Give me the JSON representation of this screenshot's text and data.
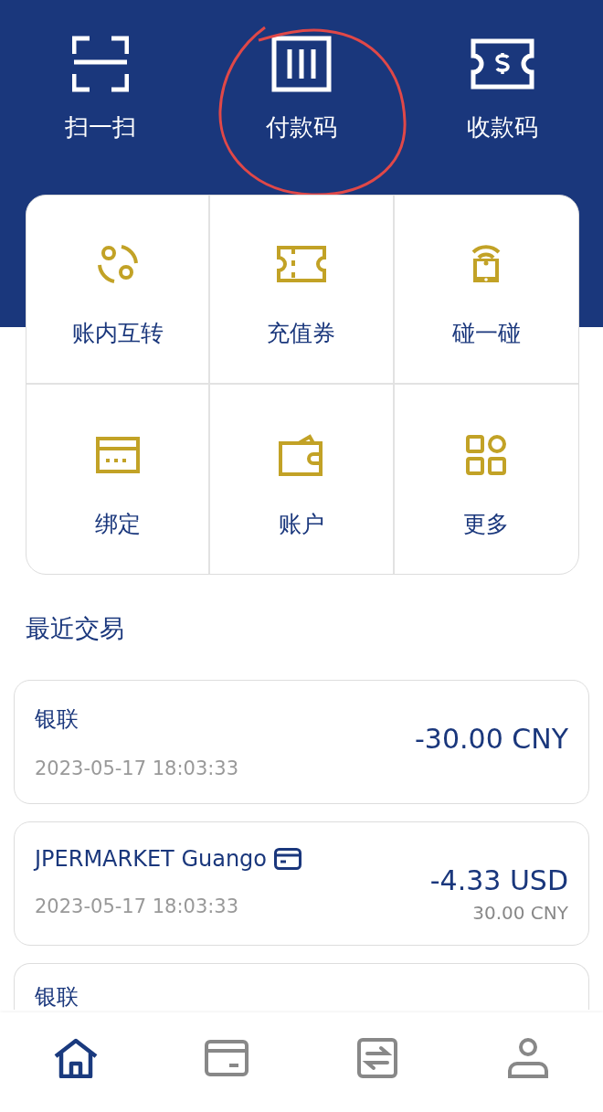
{
  "top_actions": [
    {
      "kind": "scan",
      "label": "扫一扫"
    },
    {
      "kind": "paycode",
      "label": "付款码"
    },
    {
      "kind": "receive",
      "label": "收款码"
    }
  ],
  "services": [
    {
      "kind": "transfer",
      "label": "账内互转"
    },
    {
      "kind": "voucher",
      "label": "充值券"
    },
    {
      "kind": "tap",
      "label": "碰一碰"
    },
    {
      "kind": "bind",
      "label": "绑定"
    },
    {
      "kind": "account",
      "label": "账户"
    },
    {
      "kind": "more",
      "label": "更多"
    }
  ],
  "recent": {
    "title": "最近交易",
    "transactions": [
      {
        "merchant": "银联",
        "card_icon": false,
        "time": "2023-05-17 18:03:33",
        "amount": "-30.00 CNY"
      },
      {
        "merchant": "JPERMARKET Guango",
        "card_icon": true,
        "time": "2023-05-17 18:03:33",
        "amount": "-4.33 USD",
        "converted": "30.00 CNY"
      },
      {
        "merchant": "银联",
        "card_icon": false
      }
    ]
  },
  "bottom_nav": [
    {
      "kind": "home",
      "selected": true
    },
    {
      "kind": "card",
      "selected": false
    },
    {
      "kind": "transfer",
      "selected": false
    },
    {
      "kind": "profile",
      "selected": false
    }
  ]
}
